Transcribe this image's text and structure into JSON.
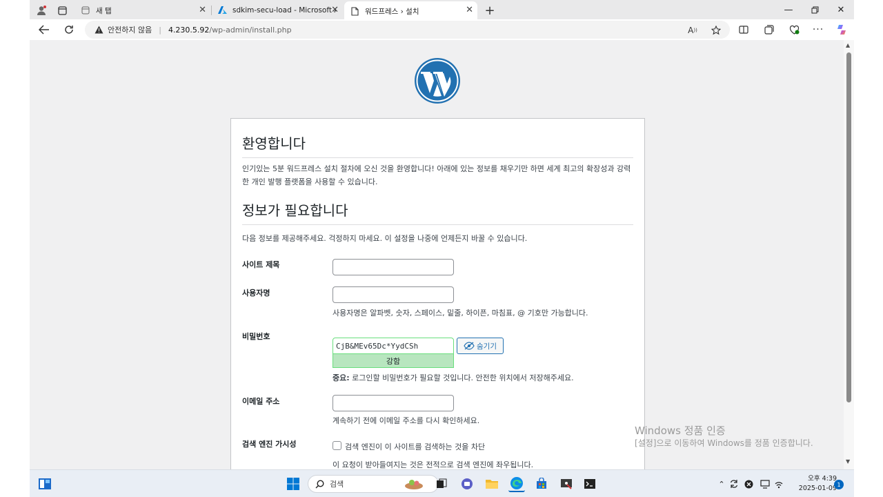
{
  "browser": {
    "tabs": [
      {
        "title": "새 탭"
      },
      {
        "title": "sdkim-secu-load - Microsoft Azure"
      },
      {
        "title": "워드프레스 › 설치"
      }
    ],
    "address": {
      "warning": "안전하지 않음",
      "host": "4.230.5.92",
      "path": "/wp-admin/install.php"
    }
  },
  "page": {
    "welcome_heading": "환영합니다",
    "welcome_text": "인기있는 5분 워드프레스 설치 절차에 오신 것을 환영합니다! 아래에 있는 정보를 채우기만 하면 세계 최고의 확장성과 강력한 개인 발행 플랫폼을 사용할 수 있습니다.",
    "info_heading": "정보가 필요합니다",
    "info_text": "다음 정보를 제공해주세요. 걱정하지 마세요. 이 설정을 나중에 언제든지 바꿀 수 있습니다.",
    "site_title_label": "사이트 제목",
    "site_title_value": "",
    "username_label": "사용자명",
    "username_value": "",
    "username_hint": "사용자명은 알파벳, 숫자, 스페이스, 밑줄, 하이픈, 마침표, @ 기호만 가능합니다.",
    "password_label": "비밀번호",
    "password_value": "CjB&MEv65Dc*YydCSh",
    "password_hide_button": "숨기기",
    "password_strength": "강함",
    "password_note_bold": "중요:",
    "password_note": "로그인할 비밀번호가 필요할 것입니다. 안전한 위치에서 저장해주세요.",
    "email_label": "이메일 주소",
    "email_value": "",
    "email_hint": "계속하기 전에 이메일 주소를 다시 확인하세요.",
    "search_label": "검색 엔진 가시성",
    "search_checkbox_label": "검색 엔진이 이 사이트를 검색하는 것을 차단",
    "search_hint": "이 요청이 받아들여지는 것은 전적으로 검색 엔진에 좌우됩니다."
  },
  "watermark": {
    "line1": "Windows 정품 인증",
    "line2": "[설정]으로 이동하여 Windows를 정품 인증합니다."
  },
  "taskbar": {
    "search_placeholder": "검색",
    "time": "오후 4:39",
    "date": "2025-01-09",
    "notification_count": "1"
  },
  "colors": {
    "wp_blue": "#2271b1",
    "strength_green": "#b8e6bf",
    "edge_accent": "#0067c0"
  }
}
